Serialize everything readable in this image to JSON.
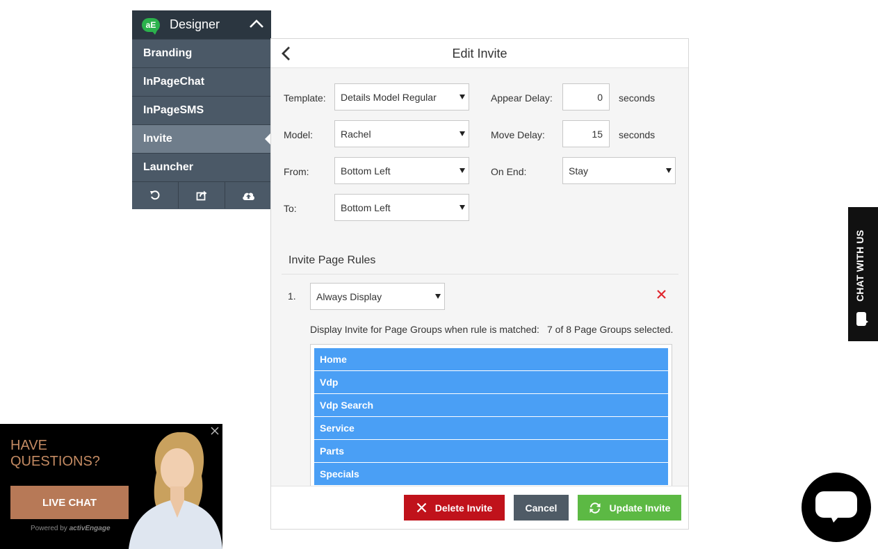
{
  "designer": {
    "logo_text": "aE",
    "title": "Designer",
    "nav": [
      {
        "label": "Branding"
      },
      {
        "label": "InPageChat"
      },
      {
        "label": "InPageSMS"
      },
      {
        "label": "Invite"
      },
      {
        "label": "Launcher"
      }
    ],
    "active_index": 3,
    "toolbar_icons": [
      "undo-icon",
      "share-icon",
      "cloud-upload-icon"
    ]
  },
  "panel": {
    "title": "Edit Invite",
    "fields": {
      "template_label": "Template:",
      "template_value": "Details Model Regular",
      "model_label": "Model:",
      "model_value": "Rachel",
      "from_label": "From:",
      "from_value": "Bottom Left",
      "to_label": "To:",
      "to_value": "Bottom Left",
      "appear_delay_label": "Appear Delay:",
      "appear_delay_value": "0",
      "move_delay_label": "Move Delay:",
      "move_delay_value": "15",
      "seconds_label": "seconds",
      "on_end_label": "On End:",
      "on_end_value": "Stay"
    },
    "rules_title": "Invite Page Rules",
    "rule": {
      "number": "1.",
      "value": "Always Display",
      "description": "Display Invite for Page Groups when rule is matched:",
      "selected_count": "7 of 8 Page Groups selected."
    },
    "page_groups": [
      "Home",
      "Vdp",
      "Vdp Search",
      "Service",
      "Parts",
      "Specials"
    ],
    "buttons": {
      "delete": "Delete Invite",
      "cancel": "Cancel",
      "update": "Update Invite"
    },
    "colors": {
      "delete": "#c0121b",
      "cancel": "#4f5b66",
      "update": "#5cb944",
      "group": "#4a9ff5"
    }
  },
  "chat_tab": {
    "label": "CHAT WITH US"
  },
  "promo": {
    "headline_line1": "HAVE",
    "headline_line2": "QUESTIONS?",
    "button": "LIVE CHAT",
    "powered_by": "Powered by",
    "brand": "activEngage"
  }
}
